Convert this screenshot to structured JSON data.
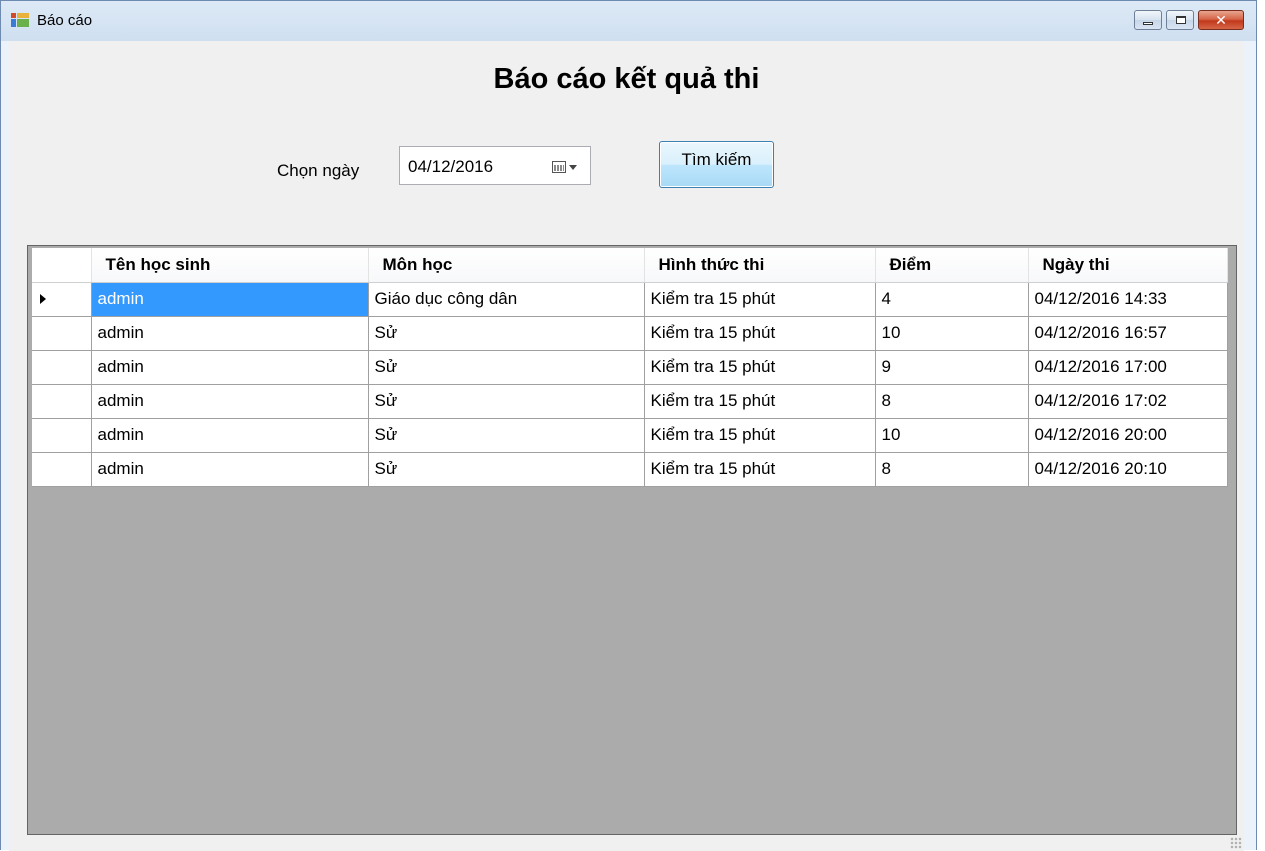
{
  "window": {
    "title": "Báo cáo",
    "close_glyph": "✕"
  },
  "form": {
    "heading": "Báo cáo kết quả thi",
    "date_label": "Chọn ngày",
    "date_value": "04/12/2016",
    "search_button": "Tìm kiếm"
  },
  "icons": {
    "app": "app-form-icon",
    "calendar": "calendar-dropdown-icon",
    "row_indicator": "current-row-arrow-icon"
  },
  "colors": {
    "selection": "#3399ff",
    "grid_background": "#ababab",
    "form_background": "#f0f0f0"
  },
  "grid": {
    "columns": [
      "Tên học sinh",
      "Môn học",
      "Hình thức thi",
      "Điểm",
      "Ngày thi"
    ],
    "rows": [
      [
        "admin",
        "Giáo dục công dân",
        "Kiểm tra 15 phút",
        "4",
        "04/12/2016 14:33"
      ],
      [
        "admin",
        "Sử",
        "Kiểm tra 15 phút",
        "10",
        "04/12/2016 16:57"
      ],
      [
        "admin",
        "Sử",
        "Kiểm tra 15 phút",
        "9",
        "04/12/2016 17:00"
      ],
      [
        "admin",
        "Sử",
        "Kiểm tra 15 phút",
        "8",
        "04/12/2016 17:02"
      ],
      [
        "admin",
        "Sử",
        "Kiểm tra 15 phút",
        "10",
        "04/12/2016 20:00"
      ],
      [
        "admin",
        "Sử",
        "Kiểm tra 15 phút",
        "8",
        "04/12/2016 20:10"
      ]
    ]
  }
}
